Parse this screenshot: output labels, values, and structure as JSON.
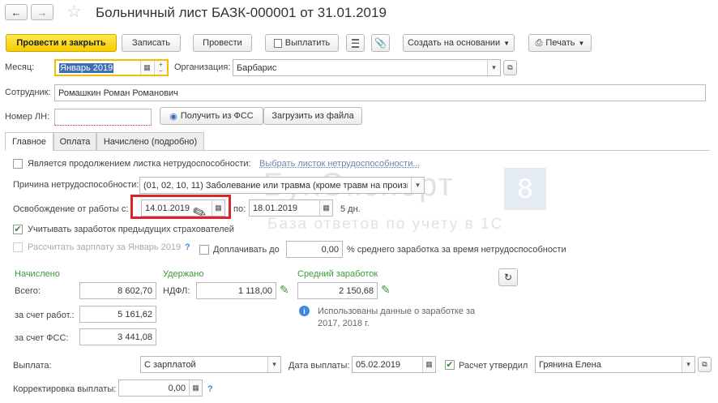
{
  "window": {
    "title": "Больничный лист БАЗК-000001 от 31.01.2019"
  },
  "toolbar": {
    "post_close": "Провести и закрыть",
    "write": "Записать",
    "post": "Провести",
    "payments": "Выплатить",
    "create_based": "Создать на основании",
    "print": "Печать"
  },
  "header": {
    "month_label": "Месяц:",
    "month_value": "Январь 2019",
    "org_label": "Организация:",
    "org_value": "Барбарис",
    "employee_label": "Сотрудник:",
    "employee_value": "Ромашкин Роман Романович",
    "ln_label": "Номер ЛН:",
    "ln_value": "",
    "get_fss": "Получить из ФСС",
    "load_file": "Загрузить из файла"
  },
  "tabs": [
    {
      "label": "Главное"
    },
    {
      "label": "Оплата"
    },
    {
      "label": "Начислено (подробно)"
    }
  ],
  "main": {
    "continuation_label": "Является продолжением листка нетрудоспособности:",
    "continuation_link": "Выбрать листок нетрудоспособности...",
    "reason_label": "Причина нетрудоспособности:",
    "reason_value": "(01, 02, 10, 11) Заболевание или травма (кроме травм на произв",
    "release_label": "Освобождение от работы с:",
    "date_from": "14.01.2019",
    "to_label": "по:",
    "date_to": "18.01.2019",
    "days": "5 дн.",
    "consider_prev": "Учитывать заработок предыдущих страхователей",
    "calc_salary": "Рассчитать зарплату за Январь 2019",
    "help": "?",
    "pay_extra": "Доплачивать до",
    "pay_extra_value": "0,00",
    "pay_extra_suffix": "% среднего заработка за время нетрудоспособности"
  },
  "totals": {
    "accrued_header": "Начислено",
    "withheld_header": "Удержано",
    "avg_header": "Средний заработок",
    "total_label": "Всего:",
    "total_value": "8 602,70",
    "ndfl_label": "НДФЛ:",
    "ndfl_value": "1 118,00",
    "avg_value": "2 150,68",
    "employer_label": "за счет работ.:",
    "employer_value": "5 161,62",
    "fss_label": "за счет ФСС:",
    "fss_value": "3 441,08",
    "info_text_1": "Использованы данные о заработке за",
    "info_text_2": "2017,  2018 г."
  },
  "payment": {
    "label": "Выплата:",
    "value": "С зарплатой",
    "date_label": "Дата выплаты:",
    "date_value": "05.02.2019",
    "approved_label": "Расчет утвердил",
    "approved_value": "Грянина Елена",
    "correction_label": "Корректировка выплаты:",
    "correction_value": "0,00"
  },
  "watermark": {
    "brand": "БухЭксперт",
    "num": "8",
    "tagline": "База ответов по учету в 1С"
  },
  "colors": {
    "primary_button": "#f6cc00",
    "highlight_box": "#d9262b",
    "green_header": "#3a9a3a",
    "link": "#6b86b0"
  }
}
